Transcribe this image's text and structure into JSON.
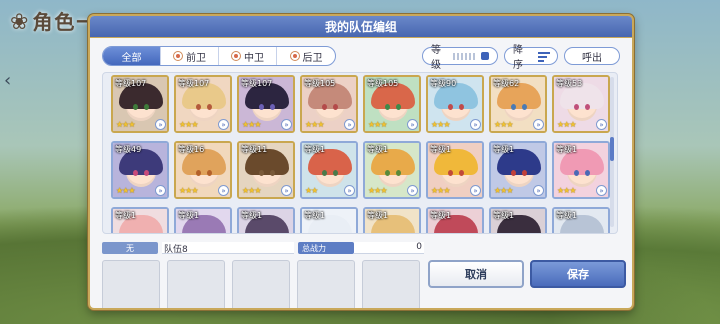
{
  "background": {
    "title": "角色一"
  },
  "modal": {
    "title": "我的队伍编组",
    "tabs": [
      {
        "label": "全部",
        "active": true
      },
      {
        "label": "前卫",
        "active": false
      },
      {
        "label": "中卫",
        "active": false
      },
      {
        "label": "后卫",
        "active": false
      }
    ],
    "filter_label": "等级",
    "sort_label": "降序",
    "call_label": "呼出"
  },
  "roster": [
    {
      "level": "等级107",
      "stars": "★★★",
      "hair": "#3b2a2e",
      "eye": "#3f7a3a",
      "bg": "#d9c7b2",
      "frame": "gold"
    },
    {
      "level": "等级107",
      "stars": "★★★",
      "hair": "#e9c98a",
      "eye": "#b45a3c",
      "bg": "#f0d7c1",
      "frame": "gold"
    },
    {
      "level": "等级107",
      "stars": "★★★",
      "hair": "#2c2540",
      "eye": "#6b5fb5",
      "bg": "#cbb7d6",
      "frame": "gold"
    },
    {
      "level": "等级105",
      "stars": "★★★",
      "hair": "#c58a7a",
      "eye": "#b44a4a",
      "bg": "#ecd1c6",
      "frame": "gold"
    },
    {
      "level": "等级105",
      "stars": "★★★",
      "hair": "#d9674a",
      "eye": "#3d8a4a",
      "bg": "#bfe0c2",
      "frame": "gold"
    },
    {
      "level": "等级90",
      "stars": "★★★",
      "hair": "#8fc4e0",
      "eye": "#c04a4a",
      "bg": "#cfe4ef",
      "frame": "gold"
    },
    {
      "level": "等级62",
      "stars": "★★★",
      "hair": "#e7a45a",
      "eye": "#4a7ab5",
      "bg": "#f2dfc3",
      "frame": "gold"
    },
    {
      "level": "等级53",
      "stars": "★★★",
      "hair": "#efe3ea",
      "eye": "#c0507a",
      "bg": "#eedbe6",
      "frame": "gold"
    },
    {
      "level": "等级49",
      "stars": "★★★",
      "hair": "#3d3a7a",
      "eye": "#c94a7a",
      "bg": "#b8b4dc",
      "frame": "blue"
    },
    {
      "level": "等级16",
      "stars": "★★★",
      "hair": "#e0a35c",
      "eye": "#b4602a",
      "bg": "#f1d8bc",
      "frame": "gold"
    },
    {
      "level": "等级11",
      "stars": "★★★",
      "hair": "#6a4a2c",
      "eye": "#7a5a3a",
      "bg": "#e5d5c0",
      "frame": "gold"
    },
    {
      "level": "等级1",
      "stars": "★★",
      "hair": "#d9634a",
      "eye": "#4a7a4a",
      "bg": "#cfe3ea",
      "frame": "blue"
    },
    {
      "level": "等级1",
      "stars": "★★★",
      "hair": "#e8aa4a",
      "eye": "#5a8a3a",
      "bg": "#d6e7c9",
      "frame": "blue"
    },
    {
      "level": "等级1",
      "stars": "★★★",
      "hair": "#f0b83a",
      "eye": "#c04a3a",
      "bg": "#f0cfc2",
      "frame": "blue"
    },
    {
      "level": "等级1",
      "stars": "★★★",
      "hair": "#2d3a8a",
      "eye": "#c0403a",
      "bg": "#c0c9e6",
      "frame": "blue"
    },
    {
      "level": "等级1",
      "stars": "★★★",
      "hair": "#f09ab4",
      "eye": "#4a6ab5",
      "bg": "#f3d2de",
      "frame": "blue"
    },
    {
      "level": "等级1",
      "stars": "",
      "hair": "#f0b0b0",
      "eye": "#b05050",
      "bg": "#f0dde0",
      "frame": "blue"
    },
    {
      "level": "等级1",
      "stars": "",
      "hair": "#9a7ab5",
      "eye": "#6a4a9a",
      "bg": "#e2d8ee",
      "frame": "blue"
    },
    {
      "level": "等级1",
      "stars": "",
      "hair": "#5a4a6a",
      "eye": "#7a5a8a",
      "bg": "#dcd4e6",
      "frame": "blue"
    },
    {
      "level": "等级1",
      "stars": "",
      "hair": "#e9eef5",
      "eye": "#8aa0c0",
      "bg": "#eef2f8",
      "frame": "blue"
    },
    {
      "level": "等级1",
      "stars": "",
      "hair": "#e7c07a",
      "eye": "#a06a3a",
      "bg": "#f1e3c8",
      "frame": "blue"
    },
    {
      "level": "等级1",
      "stars": "",
      "hair": "#c04a5a",
      "eye": "#7a2a3a",
      "bg": "#ecd0d6",
      "frame": "blue"
    },
    {
      "level": "等级1",
      "stars": "",
      "hair": "#3a2e3e",
      "eye": "#6a4a5a",
      "bg": "#dad0d6",
      "frame": "blue"
    },
    {
      "level": "等级1",
      "stars": "",
      "hair": "#b8c4d6",
      "eye": "#6a7a9a",
      "bg": "#e3e9f1",
      "frame": "blue"
    }
  ],
  "team": {
    "badge": "无",
    "name": "队伍8",
    "power_label": "总战力",
    "power_value": "0"
  },
  "buttons": {
    "cancel": "取消",
    "save": "保存"
  }
}
